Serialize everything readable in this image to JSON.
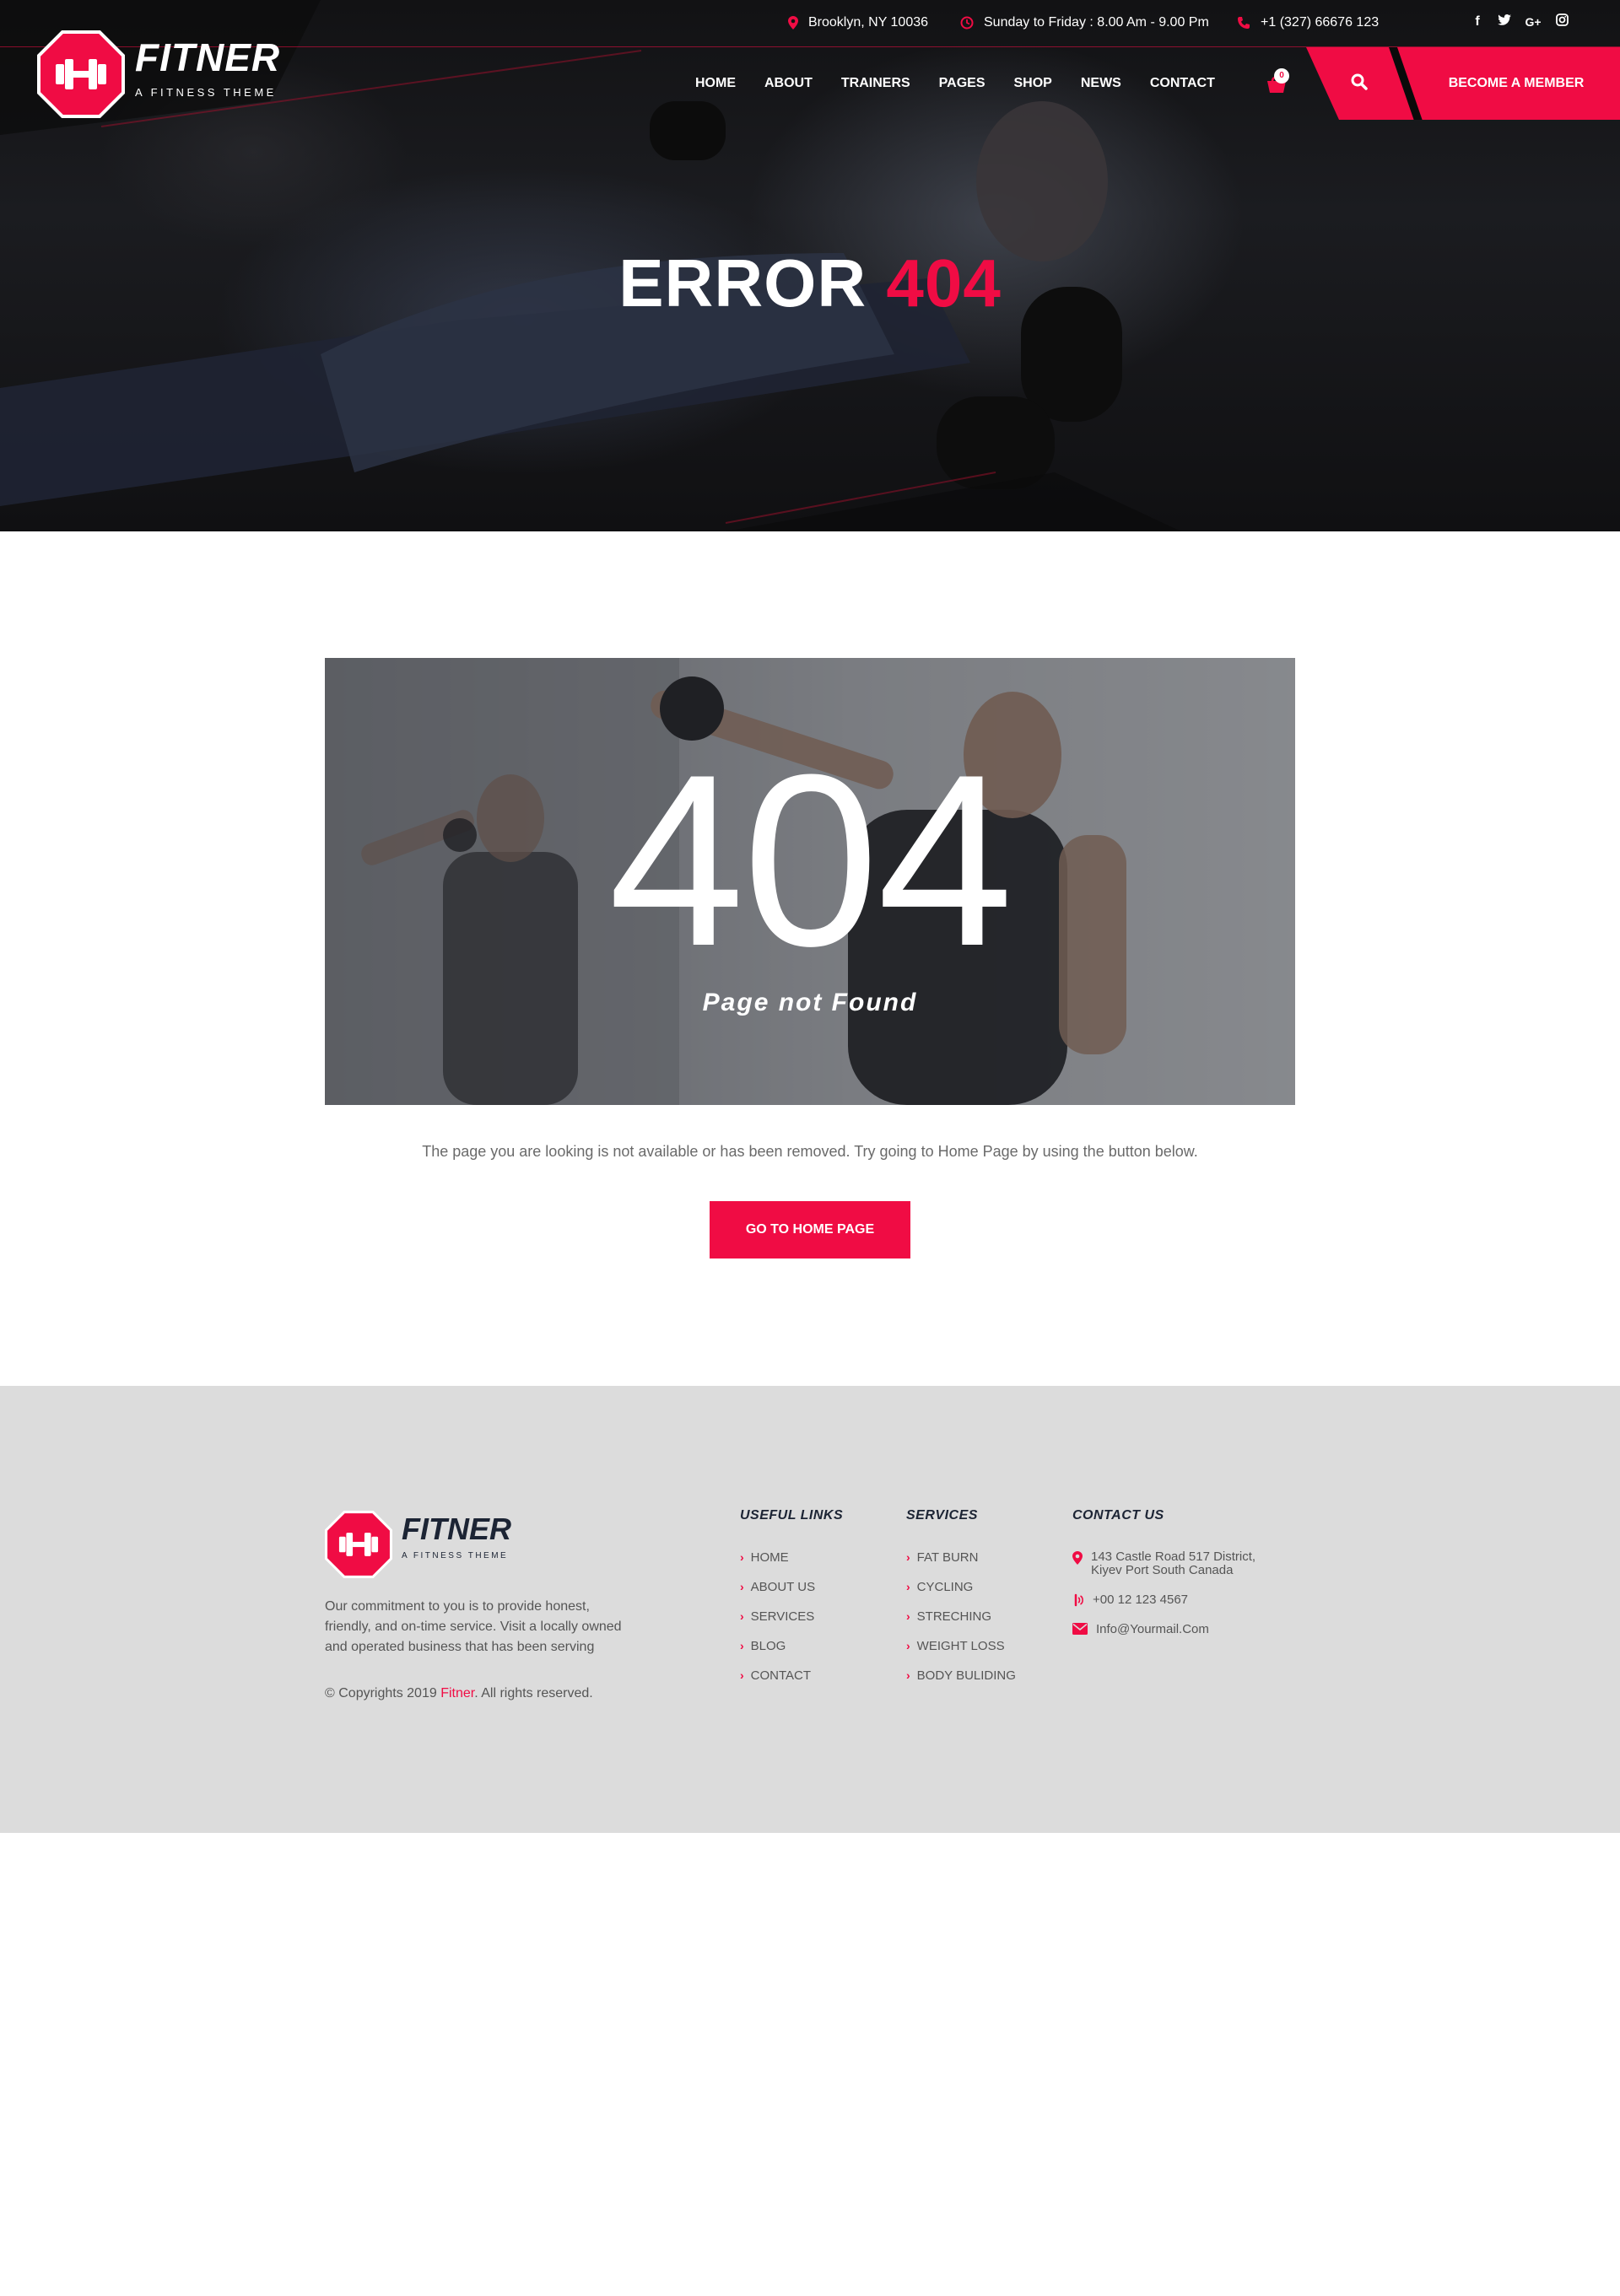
{
  "topbar": {
    "location": "Brooklyn, NY 10036",
    "hours": "Sunday to Friday : 8.00 Am - 9.00 Pm",
    "phone": "+1 (327) 66676 123",
    "social": [
      "f",
      "t",
      "G+",
      "ig"
    ]
  },
  "brand": {
    "name": "FITNER",
    "tagline": "A FITNESS THEME"
  },
  "nav": {
    "items": [
      "HOME",
      "ABOUT",
      "TRAINERS",
      "PAGES",
      "SHOP",
      "NEWS",
      "CONTACT"
    ],
    "cart_count": "0",
    "member_label": "BECOME A MEMBER"
  },
  "hero": {
    "title_main": "ERROR",
    "title_accent": "404"
  },
  "error": {
    "number": "404",
    "subtitle": "Page not Found",
    "message": "The page you are looking is not available or has been removed. Try going to Home Page by using the button below.",
    "button": "GO TO HOME PAGE"
  },
  "footer": {
    "about": "Our commitment to you is to provide honest, friendly, and on-time service. Visit a locally owned and operated business that has been serving",
    "copy_before": "© Copyrights 2019 ",
    "copy_brand": "Fitner",
    "copy_after": ". All rights reserved.",
    "useful_title": "USEFUL LINKS",
    "useful_links": [
      "HOME",
      "ABOUT US",
      "SERVICES",
      "BLOG",
      "CONTACT"
    ],
    "services_title": "SERVICES",
    "services": [
      "FAT BURN",
      "CYCLING",
      "STRECHING",
      "WEIGHT LOSS",
      "BODY BULIDING"
    ],
    "contact_title": "CONTACT US",
    "address_line1": "143 Castle Road 517 District,",
    "address_line2": "Kiyev Port South Canada",
    "phone": "+00 12 123 4567",
    "email": "Info@Yourmail.Com"
  },
  "colors": {
    "accent": "#f00c44",
    "dark": "#1c2434",
    "footer_bg": "#dcdcdc"
  },
  "icons": [
    "map-pin-icon",
    "clock-icon",
    "phone-icon",
    "facebook-icon",
    "twitter-icon",
    "google-plus-icon",
    "instagram-icon",
    "cart-icon",
    "search-icon",
    "dumbbell-logo-icon",
    "chevron-right-icon",
    "mail-icon"
  ]
}
